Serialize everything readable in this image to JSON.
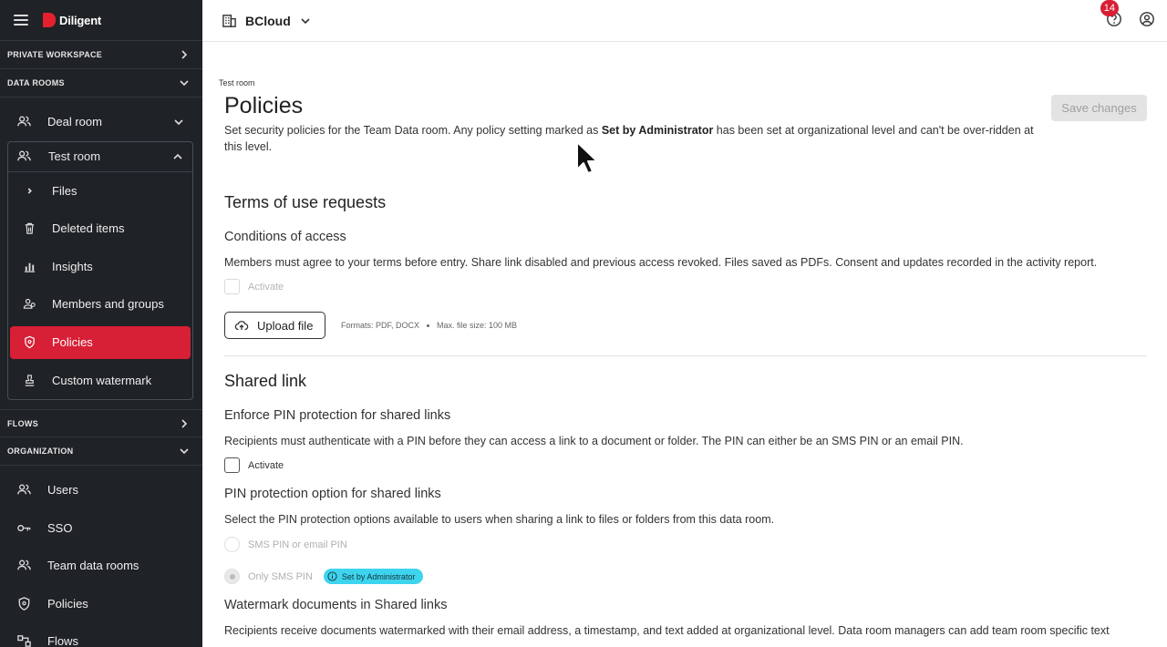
{
  "app": {
    "brand": "Diligent"
  },
  "sidebar": {
    "private_workspace": "PRIVATE WORKSPACE",
    "data_rooms": "DATA ROOMS",
    "deal_room": "Deal room",
    "test_room": "Test room",
    "room_items": [
      {
        "label": "Files"
      },
      {
        "label": "Deleted items"
      },
      {
        "label": "Insights"
      },
      {
        "label": "Members and groups"
      },
      {
        "label": "Policies"
      },
      {
        "label": "Custom watermark"
      }
    ],
    "flows": "FLOWS",
    "organization": "ORGANIZATION",
    "org_items": [
      {
        "label": "Users"
      },
      {
        "label": "SSO"
      },
      {
        "label": "Team data rooms"
      },
      {
        "label": "Policies"
      },
      {
        "label": "Flows"
      }
    ]
  },
  "topbar": {
    "workspace": "BCloud",
    "notifications": "14"
  },
  "main": {
    "breadcrumb": "Test room",
    "title": "Policies",
    "save_label": "Save changes",
    "intro_a": "Set security policies for the Team Data room. Any policy setting marked as ",
    "intro_b": "Set by Administrator",
    "intro_c": " has been set at organizational level and can't be over-ridden at this level.",
    "terms": {
      "heading": "Terms of use requests",
      "sub": "Conditions of access",
      "desc": "Members must agree to your terms before entry. Share link disabled and previous access revoked. Files saved as PDFs. Consent and updates recorded in the activity report.",
      "activate": "Activate",
      "upload": "Upload file",
      "formats": "Formats: PDF, DOCX",
      "max_size": "Max. file size: 100 MB"
    },
    "shared": {
      "heading": "Shared link",
      "enforce_title": "Enforce PIN protection for shared links",
      "enforce_desc": "Recipients must authenticate with a PIN before they can access a link to a document or folder. The PIN can either be an SMS PIN or an email PIN.",
      "activate": "Activate",
      "option_title": "PIN protection option for shared links",
      "option_desc": "Select the PIN protection options available to users when sharing a link to files or folders from this data room.",
      "opt1": "SMS PIN or email PIN",
      "opt2": "Only SMS PIN",
      "admin_badge": "Set by Administrator",
      "wm_title": "Watermark documents in Shared links",
      "wm_desc": "Recipients receive documents watermarked with their email address, a timestamp, and text added at organizational level. Data room managers can add team room specific text"
    }
  },
  "colors": {
    "sidebar_bg": "#1f2226",
    "accent": "#d71f35",
    "admin_badge": "#3fd4ee"
  }
}
